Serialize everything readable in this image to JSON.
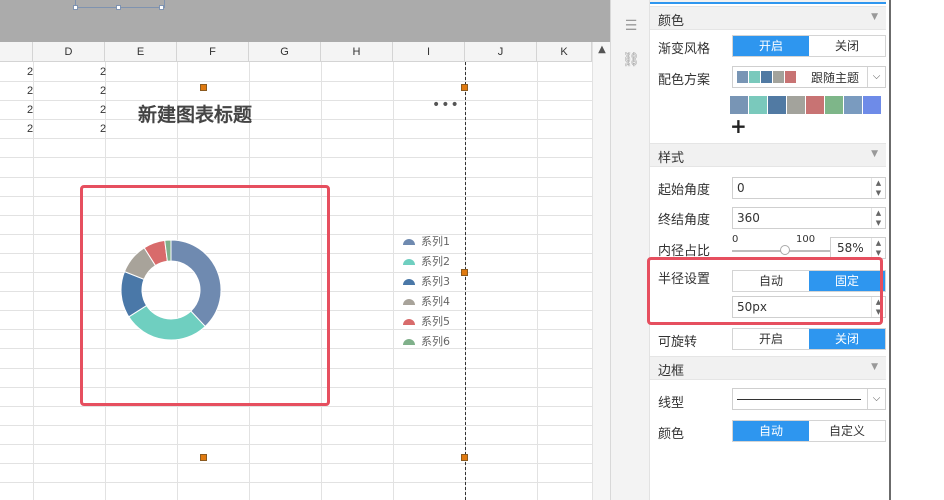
{
  "sheet": {
    "columns": [
      "D",
      "E",
      "F",
      "G",
      "H",
      "I",
      "J",
      "K"
    ],
    "cell_values": [
      "2",
      "2",
      "2",
      "2",
      "2",
      "2",
      "2",
      "2"
    ],
    "chart_title": "新建图表标题",
    "more": "•••",
    "legend": [
      "系列1",
      "系列2",
      "系列3",
      "系列4",
      "系列5",
      "系列6"
    ],
    "legend_colors": [
      "#6f8ab0",
      "#6fcfc0",
      "#4a78a8",
      "#a8a39a",
      "#d86b6b",
      "#7fb08a"
    ]
  },
  "chart_data": {
    "type": "pie",
    "categories": [
      "系列1",
      "系列2",
      "系列3",
      "系列4",
      "系列5",
      "系列6"
    ],
    "values": [
      38,
      28,
      15,
      10,
      7,
      2
    ],
    "inner_radius_percent": 58,
    "start_angle": 0,
    "end_angle": 360
  },
  "panel": {
    "color_section": "颜色",
    "gradient_label": "渐变风格",
    "gradient_on": "开启",
    "gradient_off": "关闭",
    "scheme_label": "配色方案",
    "scheme_value": "跟随主题",
    "scheme_swatches": [
      "#7895b5",
      "#7ac9bc",
      "#517aa3",
      "#a3a39c",
      "#c87373",
      "#7eb689",
      "#7a9bbf",
      "#6e8be8"
    ],
    "palette": [
      "#7895b5",
      "#7ac9bc",
      "#517aa3",
      "#a3a39c",
      "#c87373",
      "#7eb689",
      "#7a9bbf",
      "#6e8be8"
    ],
    "add": "+",
    "style_section": "样式",
    "start_angle_label": "起始角度",
    "start_angle_value": "0",
    "end_angle_label": "终结角度",
    "end_angle_value": "360",
    "inner_label": "内径占比",
    "inner_min": "0",
    "inner_max": "100",
    "inner_value": "58%",
    "radius_label": "半径设置",
    "radius_auto": "自动",
    "radius_fixed": "固定",
    "radius_value": "50px",
    "rotate_label": "可旋转",
    "rotate_on": "开启",
    "rotate_off": "关闭",
    "border_section": "边框",
    "line_label": "线型",
    "border_color_label": "颜色",
    "border_auto": "自动",
    "border_custom": "自定义"
  }
}
